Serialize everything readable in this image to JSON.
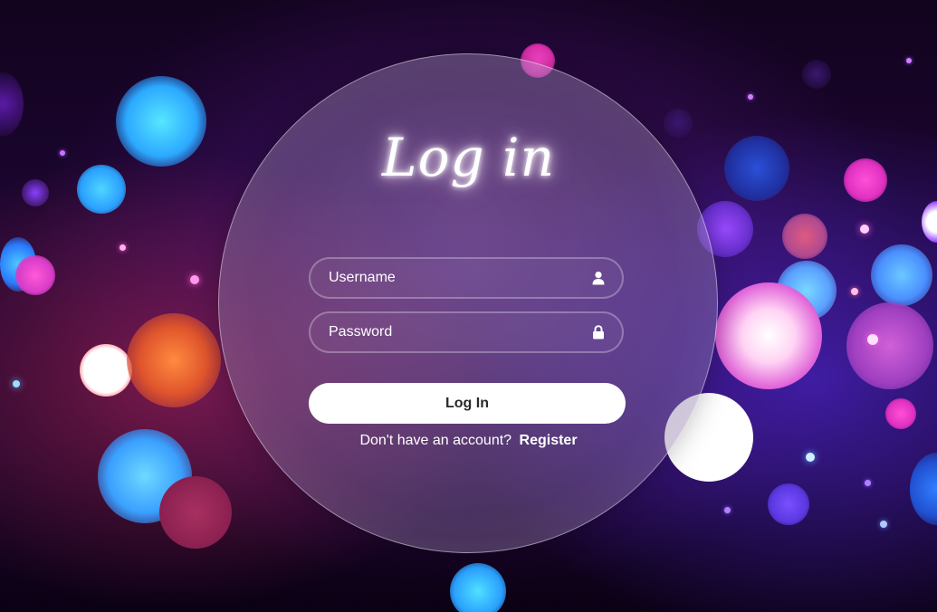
{
  "login": {
    "title": "Log in",
    "username_placeholder": "Username",
    "password_placeholder": "Password",
    "submit_label": "Log In",
    "register_prompt": "Don't have an account?",
    "register_link": "Register"
  },
  "icons": {
    "username": "user-icon",
    "password": "lock-icon"
  },
  "colors": {
    "button_bg": "#ffffff",
    "button_text": "#2a2a2a",
    "text": "#ffffff"
  }
}
